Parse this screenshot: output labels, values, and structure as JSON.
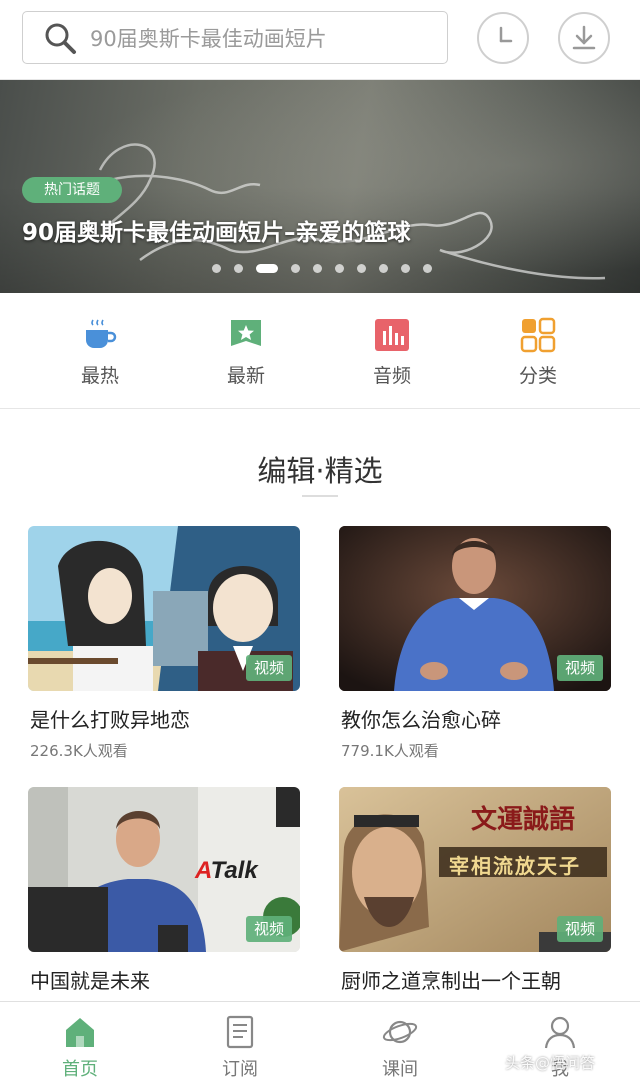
{
  "search": {
    "placeholder": "90届奥斯卡最佳动画短片"
  },
  "header": {
    "history_icon": "clock-icon",
    "download_icon": "download-icon"
  },
  "banner": {
    "tag": "热门话题",
    "title": "90届奥斯卡最佳动画短片–亲爱的篮球",
    "dots_total": 10,
    "active_dot": 2
  },
  "categories": [
    {
      "label": "最热",
      "icon": "coffee-cup-icon",
      "color": "#4a90d9"
    },
    {
      "label": "最新",
      "icon": "star-badge-icon",
      "color": "#5fb07a"
    },
    {
      "label": "音频",
      "icon": "audio-bars-icon",
      "color": "#e8636a"
    },
    {
      "label": "分类",
      "icon": "grid-icon",
      "color": "#f0a030"
    }
  ],
  "section": {
    "title": "编辑·精选"
  },
  "cards": [
    {
      "title": "是什么打败异地恋",
      "views": "226.3K人观看",
      "badge": "视频"
    },
    {
      "title": "教你怎么治愈心碎",
      "views": "779.1K人观看",
      "badge": "视频"
    },
    {
      "title": "中国就是未来",
      "badge": "视频",
      "brand": "Talk",
      "brand_prefix": "A"
    },
    {
      "title": "厨师之道烹制出一个王朝",
      "badge": "视频",
      "caption_top": "文運誠語",
      "caption_main": "宰相流放天子"
    }
  ],
  "bottom_nav": [
    {
      "label": "首页",
      "icon": "home-icon",
      "active": true
    },
    {
      "label": "订阅",
      "icon": "document-icon",
      "active": false
    },
    {
      "label": "课间",
      "icon": "planet-icon",
      "active": false
    },
    {
      "label": "我",
      "icon": "user-icon",
      "active": false
    }
  ],
  "watermark": "头条@悟问答",
  "colors": {
    "accent": "#5fb07a",
    "text": "#222222",
    "muted": "#777777"
  }
}
